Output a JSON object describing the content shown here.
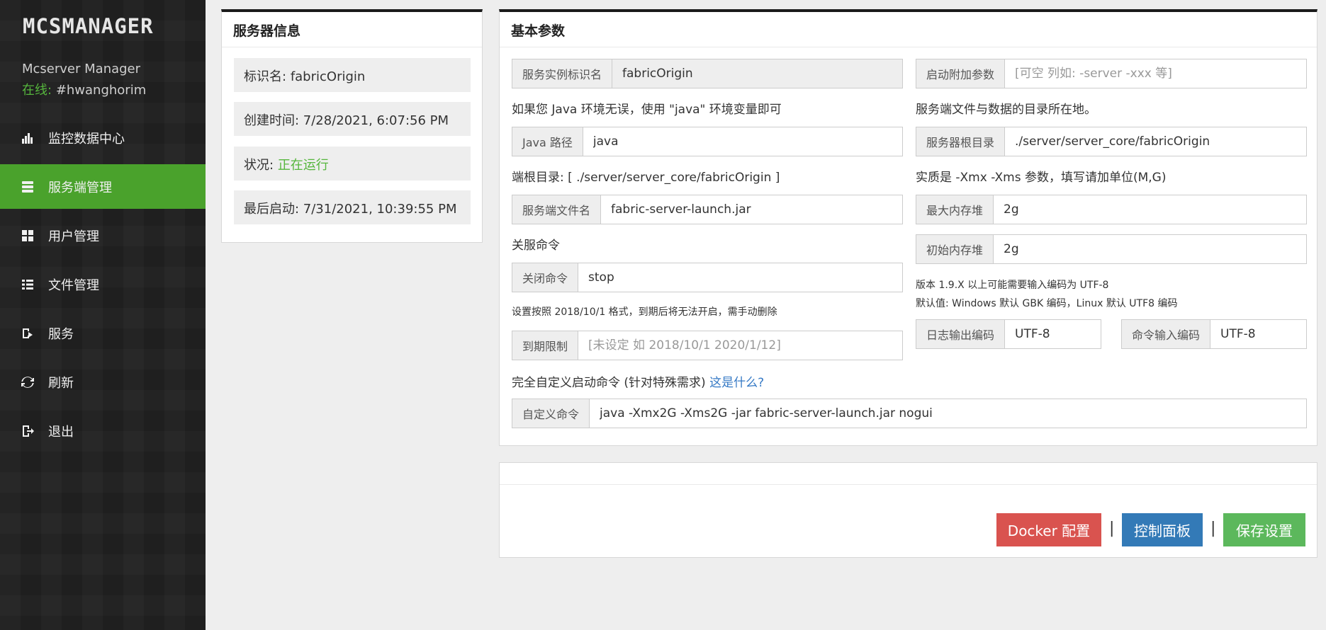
{
  "sidebar": {
    "logo": "MCSMANAGER",
    "app_name": "Mcserver Manager",
    "online_label": "在线:",
    "username": "#hwanghorim",
    "items": [
      {
        "label": "监控数据中心",
        "icon": "bar-chart-icon",
        "active": false
      },
      {
        "label": "服务端管理",
        "icon": "server-icon",
        "active": true
      },
      {
        "label": "用户管理",
        "icon": "grid-icon",
        "active": false
      },
      {
        "label": "文件管理",
        "icon": "list-icon",
        "active": false
      },
      {
        "label": "服务",
        "icon": "service-icon",
        "active": false
      },
      {
        "label": "刷新",
        "icon": "refresh-icon",
        "active": false
      },
      {
        "label": "退出",
        "icon": "logout-icon",
        "active": false
      }
    ]
  },
  "info": {
    "title": "服务器信息",
    "name_label": "标识名:",
    "name_value": "fabricOrigin",
    "created": "创建时间: 7/28/2021, 6:07:56 PM",
    "status_label": "状况:",
    "status_value": "正在运行",
    "last_start": "最后启动: 7/31/2021, 10:39:55 PM"
  },
  "params": {
    "title": "基本参数",
    "instance_id_label": "服务实例标识名",
    "instance_id_value": "fabricOrigin",
    "java_hint": "如果您 Java 环境无误，使用 \"java\" 环境变量即可",
    "java_label": "Java 路径",
    "java_value": "java",
    "root_hint": "端根目录: [ ./server/server_core/fabricOrigin ]",
    "jar_label": "服务端文件名",
    "jar_value": "fabric-server-launch.jar",
    "stop_hint": "关服命令",
    "stop_label": "关闭命令",
    "stop_value": "stop",
    "expire_hint": "设置按照 2018/10/1 格式，到期后将无法开启，需手动删除",
    "expire_label": "到期限制",
    "expire_placeholder": "[未设定 如 2018/10/1 2020/1/12]",
    "extra_label": "启动附加参数",
    "extra_placeholder": "[可空 列如: -server -xxx 等]",
    "dir_hint": "服务端文件与数据的目录所在地。",
    "dir_label": "服务器根目录",
    "dir_value": "./server/server_core/fabricOrigin",
    "mem_hint": "实质是 -Xmx -Xms 参数，填写请加单位(M,G)",
    "max_mem_label": "最大内存堆",
    "max_mem_value": "2g",
    "init_mem_label": "初始内存堆",
    "init_mem_value": "2g",
    "encoding_hint_1": "版本 1.9.X 以上可能需要输入编码为 UTF-8",
    "encoding_hint_2": "默认值: Windows 默认 GBK 编码，Linux 默认 UTF8 编码",
    "log_enc_label": "日志输出编码",
    "log_enc_value": "UTF-8",
    "cmd_enc_label": "命令输入编码",
    "cmd_enc_value": "UTF-8",
    "custom_hint": "完全自定义启动命令 (针对特殊需求)",
    "custom_link": "这是什么?",
    "custom_label": "自定义命令",
    "custom_value": "java -Xmx2G -Xms2G -jar fabric-server-launch.jar nogui"
  },
  "actions": {
    "docker": "Docker 配置",
    "console": "控制面板",
    "save": "保存设置",
    "separator": "|"
  },
  "colors": {
    "sidebar_bg": "#1f1f1f",
    "active_green": "#4aa22c",
    "status_green": "#56b63d",
    "docker_red": "#d9534f",
    "console_blue": "#337ab7",
    "save_green": "#5cb85c"
  }
}
